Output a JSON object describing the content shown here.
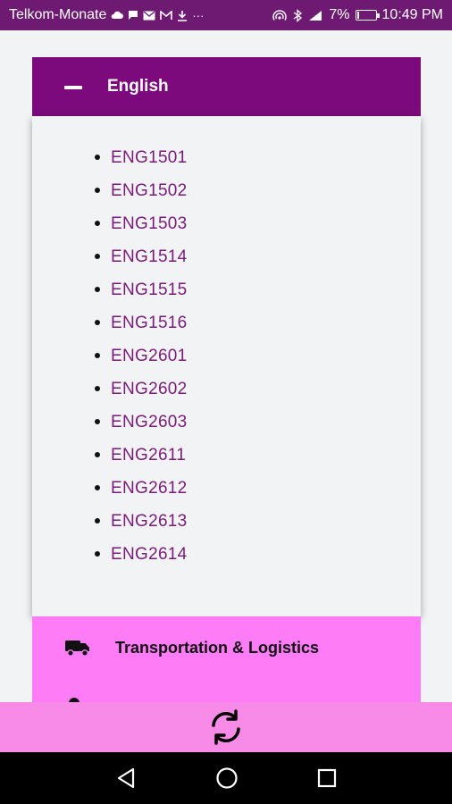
{
  "status_bar": {
    "carrier": "Telkom-Monate",
    "battery": "7%",
    "battery_level": 0.07,
    "time": "10:49 PM",
    "icons": [
      "cloud-icon",
      "chat-icon",
      "mail-icon",
      "gmail-icon",
      "download-icon",
      "more-icon",
      "hotspot-icon",
      "bluetooth-icon",
      "signal-icon",
      "battery-icon"
    ]
  },
  "accordion": {
    "title": "English",
    "expanded": true,
    "courses": [
      "ENG1501",
      "ENG1502",
      "ENG1503",
      "ENG1514",
      "ENG1515",
      "ENG1516",
      "ENG2601",
      "ENG2602",
      "ENG2603",
      "ENG2611",
      "ENG2612",
      "ENG2613",
      "ENG2614"
    ]
  },
  "category": {
    "label": "Transportation & Logistics",
    "icon": "truck-icon"
  },
  "refresh": {
    "icon": "refresh-icon"
  },
  "nav_bar": {
    "icons": [
      "back-icon",
      "home-icon",
      "recents-icon"
    ]
  },
  "colors": {
    "status_bar": "#6e1a73",
    "accordion_header": "#7c0a7c",
    "link": "#7a1a7a",
    "category_bg": "#ff7cf7",
    "refresh_bar": "#f88be8"
  }
}
